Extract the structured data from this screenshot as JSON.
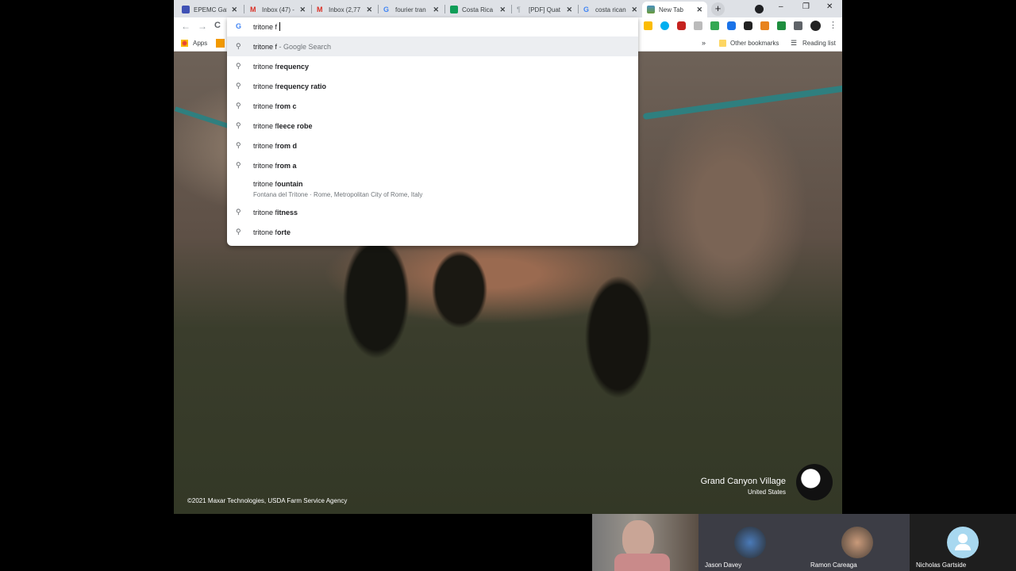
{
  "tabs": [
    {
      "title": "EPEMC Gat",
      "color": "#3f51b5"
    },
    {
      "title": "Inbox (47) -",
      "color": "#d93025"
    },
    {
      "title": "Inbox (2,77",
      "color": "#d93025"
    },
    {
      "title": "fourier tran",
      "color": "#4285f4"
    },
    {
      "title": "Costa Rica",
      "color": "#0f9d58"
    },
    {
      "title": "[PDF] Quat",
      "color": "#9aa0a6"
    },
    {
      "title": "costa rican",
      "color": "#4285f4"
    },
    {
      "title": "New Tab",
      "color": "#5a8a3a",
      "active": true
    }
  ],
  "toolbar": {
    "back": "←",
    "forward": "→",
    "reload": "C",
    "new_tab": "+",
    "minimize": "–",
    "restore": "❐",
    "close": "✕",
    "menu": "⋮"
  },
  "omnibox": {
    "value": "tritone f"
  },
  "bookmarks": {
    "apps": "Apps",
    "more": "»",
    "other": "Other bookmarks",
    "reading": "Reading list"
  },
  "suggestions": [
    {
      "typed": "tritone f",
      "rest": " - Google Search",
      "icon": "search"
    },
    {
      "typed": "tritone f",
      "rest": "requency",
      "icon": "search"
    },
    {
      "typed": "tritone f",
      "rest": "requency ratio",
      "icon": "search"
    },
    {
      "typed": "tritone f",
      "rest": "rom c",
      "icon": "search"
    },
    {
      "typed": "tritone f",
      "rest": "leece robe",
      "icon": "search"
    },
    {
      "typed": "tritone f",
      "rest": "rom d",
      "icon": "search"
    },
    {
      "typed": "tritone f",
      "rest": "rom a",
      "icon": "search"
    },
    {
      "typed": "tritone f",
      "rest": "ountain",
      "sub": "Fontana del Tritone · Rome, Metropolitan City of Rome, Italy",
      "icon": "place"
    },
    {
      "typed": "tritone f",
      "rest": "itness",
      "icon": "search"
    },
    {
      "typed": "tritone f",
      "rest": "orte",
      "icon": "search"
    }
  ],
  "background": {
    "place": "Grand Canyon Village",
    "country": "United States",
    "credit": "©2021 Maxar Technologies, USDA Farm Service Agency"
  },
  "participants": [
    "Jason Davey",
    "Ramon Careaga",
    "Nicholas Gartside"
  ]
}
